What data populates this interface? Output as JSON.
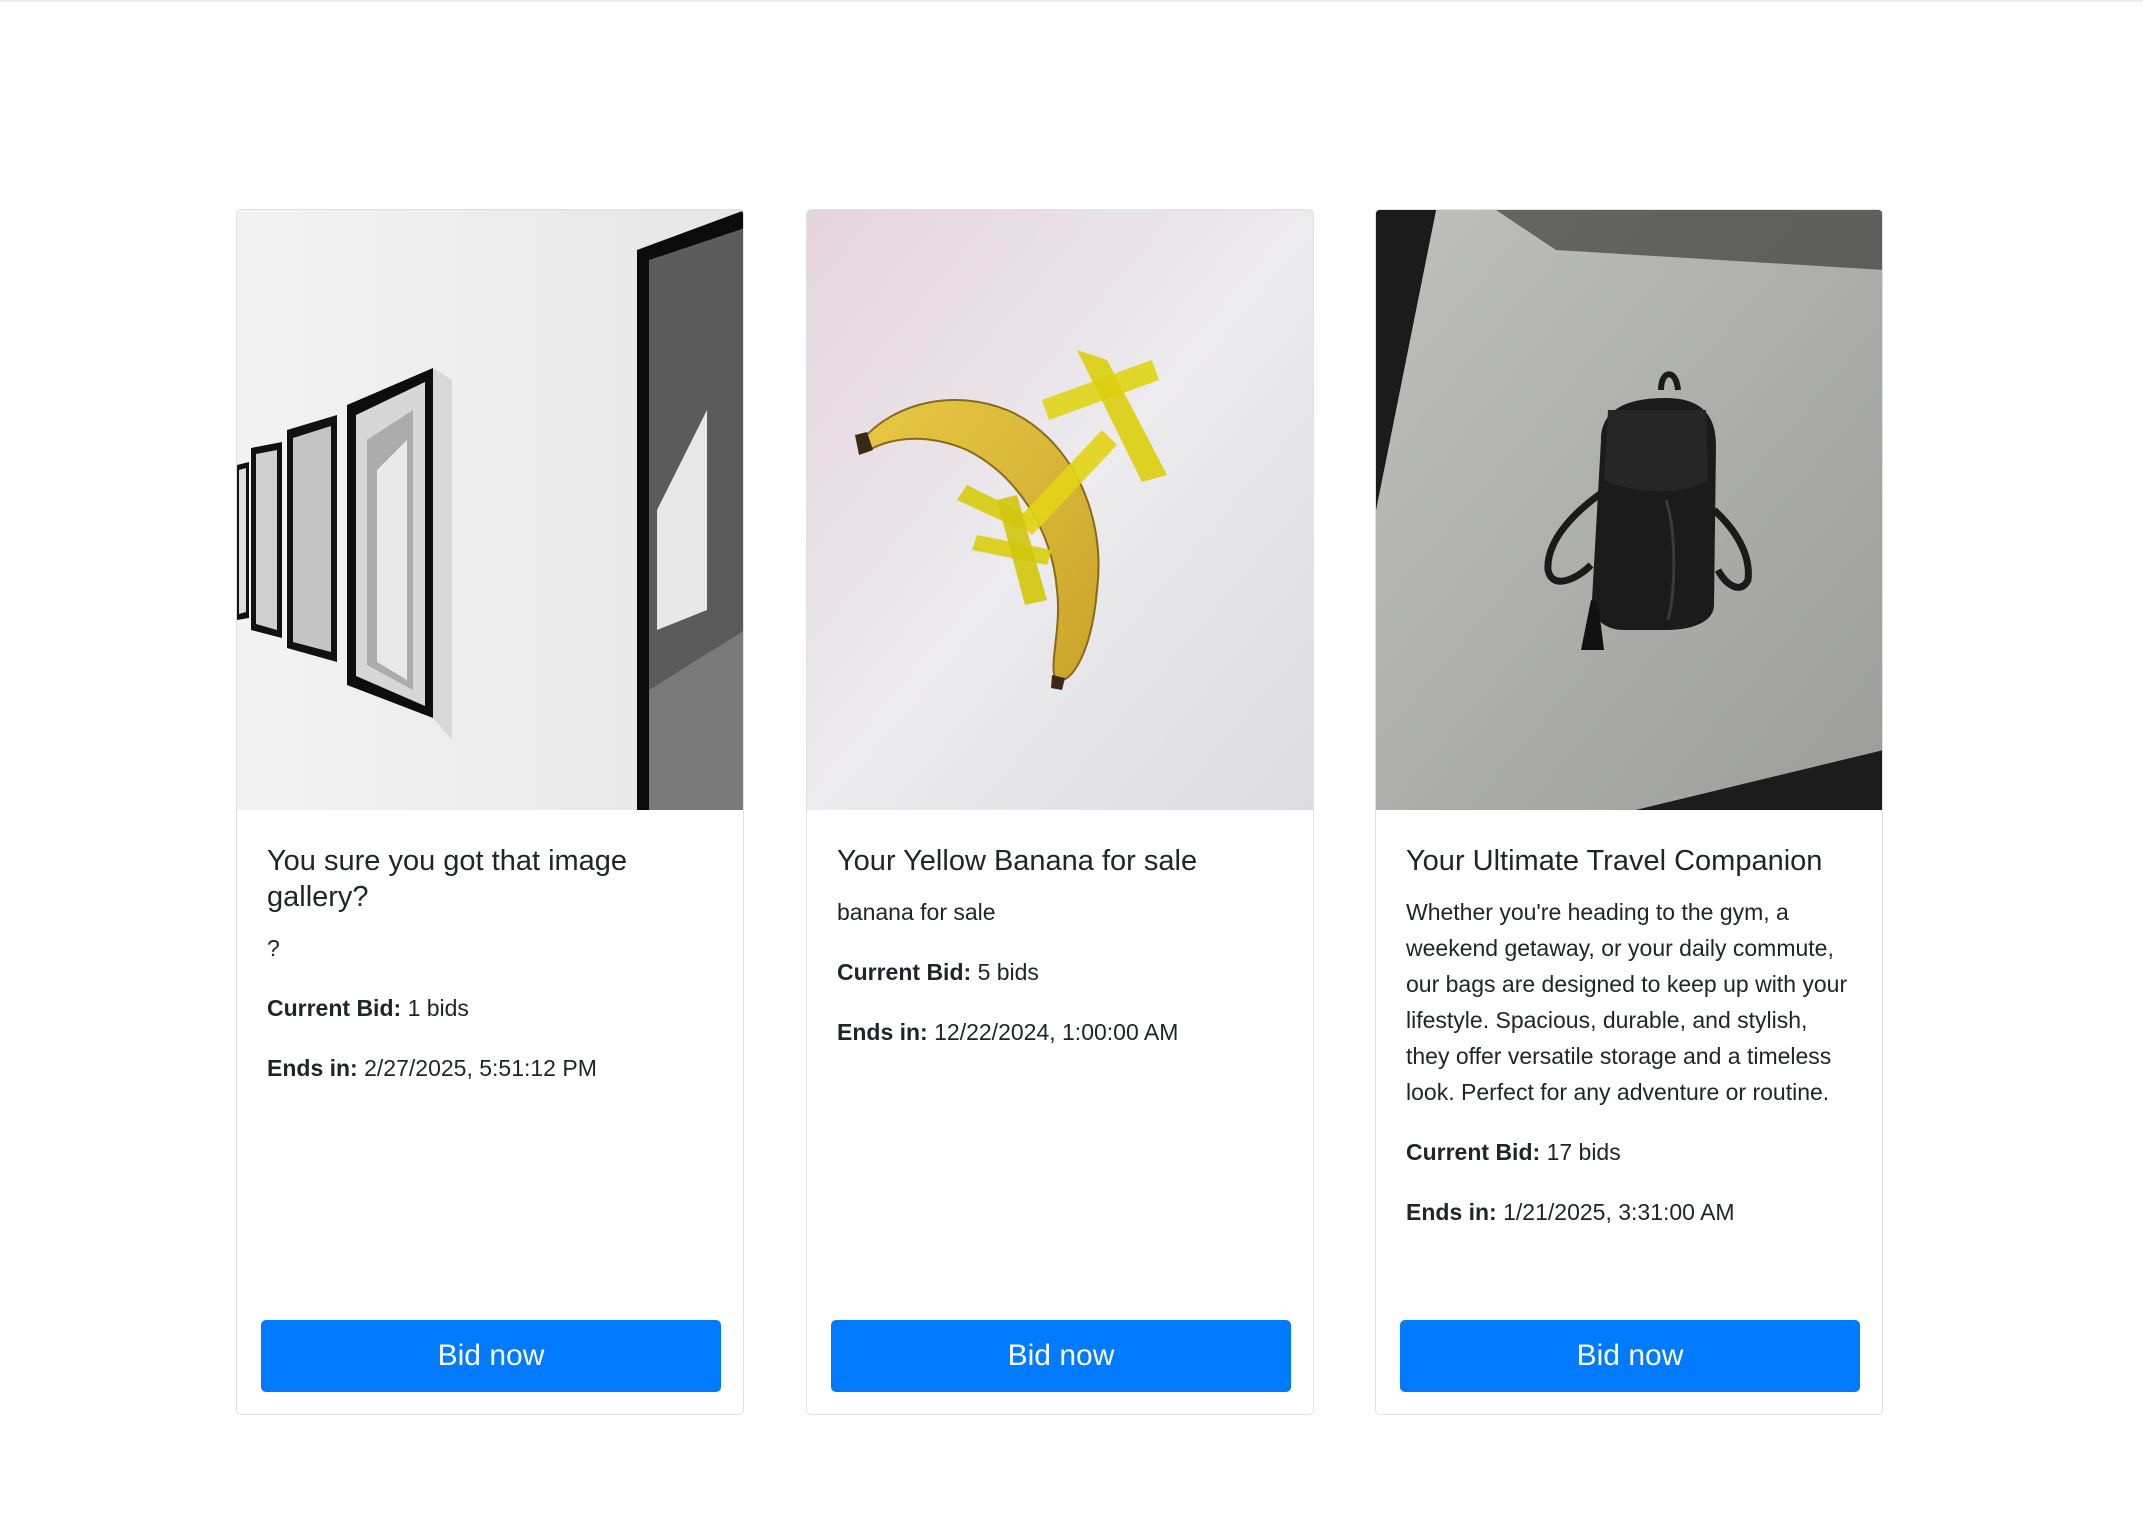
{
  "cards": [
    {
      "title": "You sure you got that image gallery?",
      "description": "?",
      "current_bid_label": "Current Bid:",
      "current_bid_value": "1 bids",
      "ends_label": "Ends in:",
      "ends_value": "2/27/2025, 5:51:12 PM",
      "button_label": "Bid now"
    },
    {
      "title": "Your Yellow Banana for sale",
      "description": "banana for sale",
      "current_bid_label": "Current Bid:",
      "current_bid_value": "5 bids",
      "ends_label": "Ends in:",
      "ends_value": "12/22/2024, 1:00:00 AM",
      "button_label": "Bid now"
    },
    {
      "title": "Your Ultimate Travel Companion",
      "description": "Whether you're heading to the gym, a weekend getaway, or your daily commute, our bags are designed to keep up with your lifestyle. Spacious, durable, and stylish, they offer versatile storage and a timeless look. Perfect for any adventure or routine.",
      "current_bid_label": "Current Bid:",
      "current_bid_value": "17 bids",
      "ends_label": "Ends in:",
      "ends_value": "1/21/2025, 3:31:00 AM",
      "button_label": "Bid now"
    }
  ],
  "colors": {
    "button": "#007bff",
    "button_text": "#ffffff",
    "text": "#212529",
    "card_border": "#dfe1e4"
  }
}
